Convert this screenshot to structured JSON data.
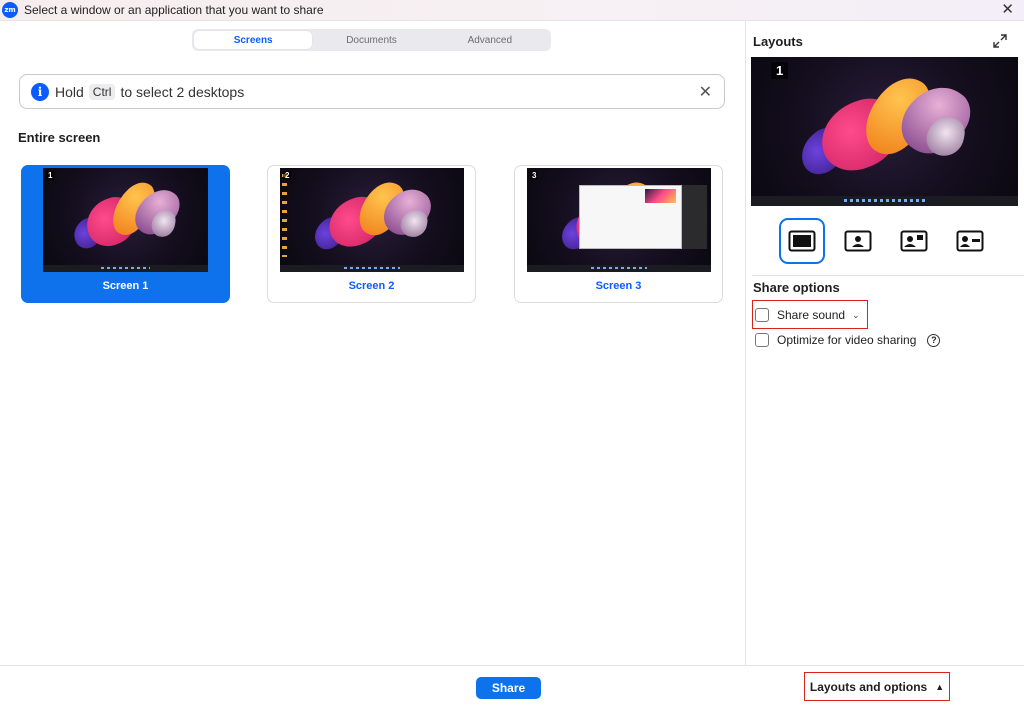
{
  "window": {
    "app_logo_text": "zm",
    "title": "Select a window or an application that you want to share",
    "close_icon": "close-icon"
  },
  "tabs": [
    {
      "label": "Screens",
      "active": true
    },
    {
      "label": "Documents",
      "active": false
    },
    {
      "label": "Advanced",
      "active": false
    }
  ],
  "info_banner": {
    "prefix": "Hold",
    "key": "Ctrl",
    "suffix": "to select 2 desktops"
  },
  "section_title": "Entire screen",
  "screens": [
    {
      "number": "1",
      "label": "Screen 1",
      "selected": true
    },
    {
      "number": "2",
      "label": "Screen 2",
      "selected": false
    },
    {
      "number": "3",
      "label": "Screen 3",
      "selected": false
    }
  ],
  "layouts_panel": {
    "title": "Layouts",
    "preview_number": "1",
    "layout_options": [
      {
        "icon": "screen-only-icon",
        "active": true
      },
      {
        "icon": "side-presenter-icon",
        "active": false
      },
      {
        "icon": "presenter-overlay-icon",
        "active": false
      },
      {
        "icon": "presenter-card-icon",
        "active": false
      }
    ]
  },
  "share_options": {
    "title": "Share options",
    "share_sound": "Share sound",
    "optimize_video": "Optimize for video sharing",
    "help_glyph": "?"
  },
  "footer": {
    "share_label": "Share",
    "layouts_toggle_label": "Layouts and options"
  },
  "colors": {
    "accent": "#0e72ed",
    "highlight_red": "#d9241b"
  }
}
